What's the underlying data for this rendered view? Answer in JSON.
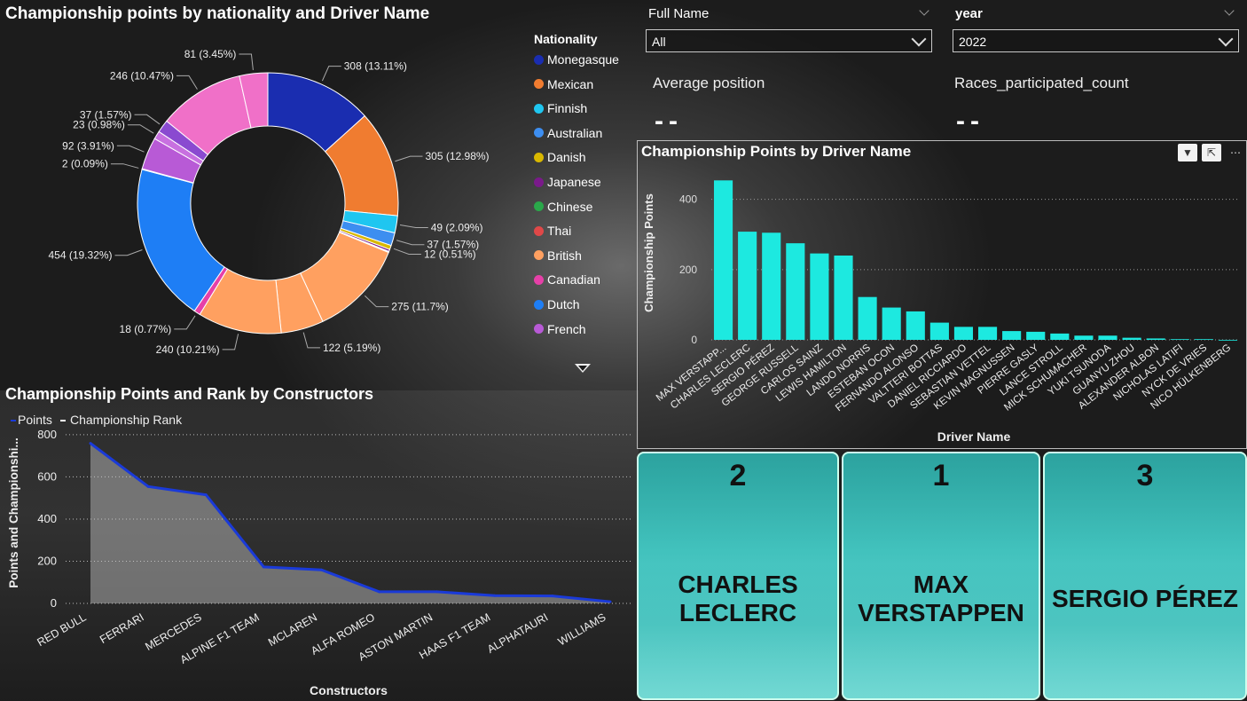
{
  "donut": {
    "title": "Championship points by nationality and Driver Name",
    "legend_title": "Nationality",
    "legend": [
      {
        "name": "Monegasque",
        "color": "#1a2db0"
      },
      {
        "name": "Mexican",
        "color": "#f07c30"
      },
      {
        "name": "Finnish",
        "color": "#1fc6f0"
      },
      {
        "name": "Australian",
        "color": "#3d8ef0"
      },
      {
        "name": "Danish",
        "color": "#d9b800"
      },
      {
        "name": "Japanese",
        "color": "#7a1a8a"
      },
      {
        "name": "Chinese",
        "color": "#2aa84a"
      },
      {
        "name": "Thai",
        "color": "#e04848"
      },
      {
        "name": "British",
        "color": "#ffa060"
      },
      {
        "name": "Canadian",
        "color": "#e640a8"
      },
      {
        "name": "Dutch",
        "color": "#1e7ef5"
      },
      {
        "name": "French",
        "color": "#b85ad6"
      }
    ]
  },
  "slicers": {
    "full_name": {
      "label": "Full Name",
      "value": "All"
    },
    "year": {
      "label": "year",
      "value": "2022"
    }
  },
  "kpis": {
    "avg_position": {
      "label": "Average position",
      "value": "--"
    },
    "races_count": {
      "label": "Races_participated_count",
      "value": "--"
    }
  },
  "driver_chart": {
    "title": "Championship Points by Driver Name"
  },
  "constructor_chart": {
    "title": "Championship Points and Rank by Constructors"
  },
  "podium": [
    {
      "rank": "2",
      "name_line1": "CHARLES",
      "name_line2": "LECLERC"
    },
    {
      "rank": "1",
      "name_line1": "MAX",
      "name_line2": "VERSTAPPEN"
    },
    {
      "rank": "3",
      "name_line1": "SERGIO PÉREZ",
      "name_line2": ""
    }
  ],
  "chart_data": [
    {
      "type": "pie",
      "title": "Championship points by nationality and Driver Name",
      "slices": [
        {
          "value": 308,
          "label": "308 (13.11%)",
          "color": "#1a2db0"
        },
        {
          "value": 305,
          "label": "305 (12.98%)",
          "color": "#f07c30"
        },
        {
          "value": 49,
          "label": "49 (2.09%)",
          "color": "#1fc6f0"
        },
        {
          "value": 37,
          "label": "37 (1.57%)",
          "color": "#3d8ef0"
        },
        {
          "value": 12,
          "label": "12 (0.51%)",
          "color": "#d9b800"
        },
        {
          "value": 6,
          "label": "",
          "color": "#7a1a8a"
        },
        {
          "value": 2,
          "label": "",
          "color": "#2aa84a"
        },
        {
          "value": 1,
          "label": "",
          "color": "#e04848"
        },
        {
          "value": 275,
          "label": "275 (11.7%)",
          "color": "#ffa060"
        },
        {
          "value": 122,
          "label": "122 (5.19%)",
          "color": "#ffa060"
        },
        {
          "value": 240,
          "label": "240 (10.21%)",
          "color": "#ffa060"
        },
        {
          "value": 18,
          "label": "18 (0.77%)",
          "color": "#e640a8"
        },
        {
          "value": 454,
          "label": "454 (19.32%)",
          "color": "#1e7ef5"
        },
        {
          "value": 2,
          "label": "2 (0.09%)",
          "color": "#b85ad6"
        },
        {
          "value": 92,
          "label": "92 (3.91%)",
          "color": "#b85ad6"
        },
        {
          "value": 23,
          "label": "23 (0.98%)",
          "color": "#c870e0"
        },
        {
          "value": 37,
          "label": "37 (1.57%)",
          "color": "#8a4ad0"
        },
        {
          "value": 246,
          "label": "246 (10.47%)",
          "color": "#f070c8"
        },
        {
          "value": 81,
          "label": "81 (3.45%)",
          "color": "#f070c8"
        }
      ]
    },
    {
      "type": "bar",
      "title": "Championship Points by Driver Name",
      "xlabel": "Driver Name",
      "ylabel": "Championship Points",
      "ylim": [
        0,
        480
      ],
      "yticks": [
        0,
        200,
        400
      ],
      "color": "#1de9e0",
      "categories": [
        "MAX VERSTAPP...",
        "CHARLES LECLERC",
        "SERGIO PÉREZ",
        "GEORGE RUSSELL",
        "CARLOS SAINZ",
        "LEWIS HAMILTON",
        "LANDO NORRIS",
        "ESTEBAN OCON",
        "FERNANDO ALONSO",
        "VALTTERI BOTTAS",
        "DANIEL RICCIARDO",
        "SEBASTIAN VETTEL",
        "KEVIN MAGNUSSEN",
        "PIERRE GASLY",
        "LANCE STROLL",
        "MICK SCHUMACHER",
        "YUKI TSUNODA",
        "GUANYU ZHOU",
        "ALEXANDER ALBON",
        "NICHOLAS LATIFI",
        "NYCK DE VRIES",
        "NICO HÜLKENBERG"
      ],
      "values": [
        454,
        308,
        305,
        275,
        246,
        240,
        122,
        92,
        81,
        49,
        37,
        37,
        25,
        23,
        18,
        12,
        12,
        6,
        4,
        2,
        2,
        0
      ]
    },
    {
      "type": "area",
      "title": "Championship Points and Rank by Constructors",
      "xlabel": "Constructors",
      "ylabel": "Points and Championshi...",
      "ylim": [
        0,
        850
      ],
      "yticks": [
        0,
        200,
        400,
        600,
        800
      ],
      "legend": [
        "Points",
        "Championship Rank"
      ],
      "categories": [
        "RED BULL",
        "FERRARI",
        "MERCEDES",
        "ALPINE F1 TEAM",
        "MCLAREN",
        "ALFA ROMEO",
        "ASTON MARTIN",
        "HAAS F1 TEAM",
        "ALPHATAURI",
        "WILLIAMS"
      ],
      "series": [
        {
          "name": "Points",
          "values": [
            759,
            554,
            515,
            173,
            159,
            55,
            55,
            37,
            35,
            8
          ],
          "color": "#1a3ad8"
        }
      ]
    }
  ]
}
